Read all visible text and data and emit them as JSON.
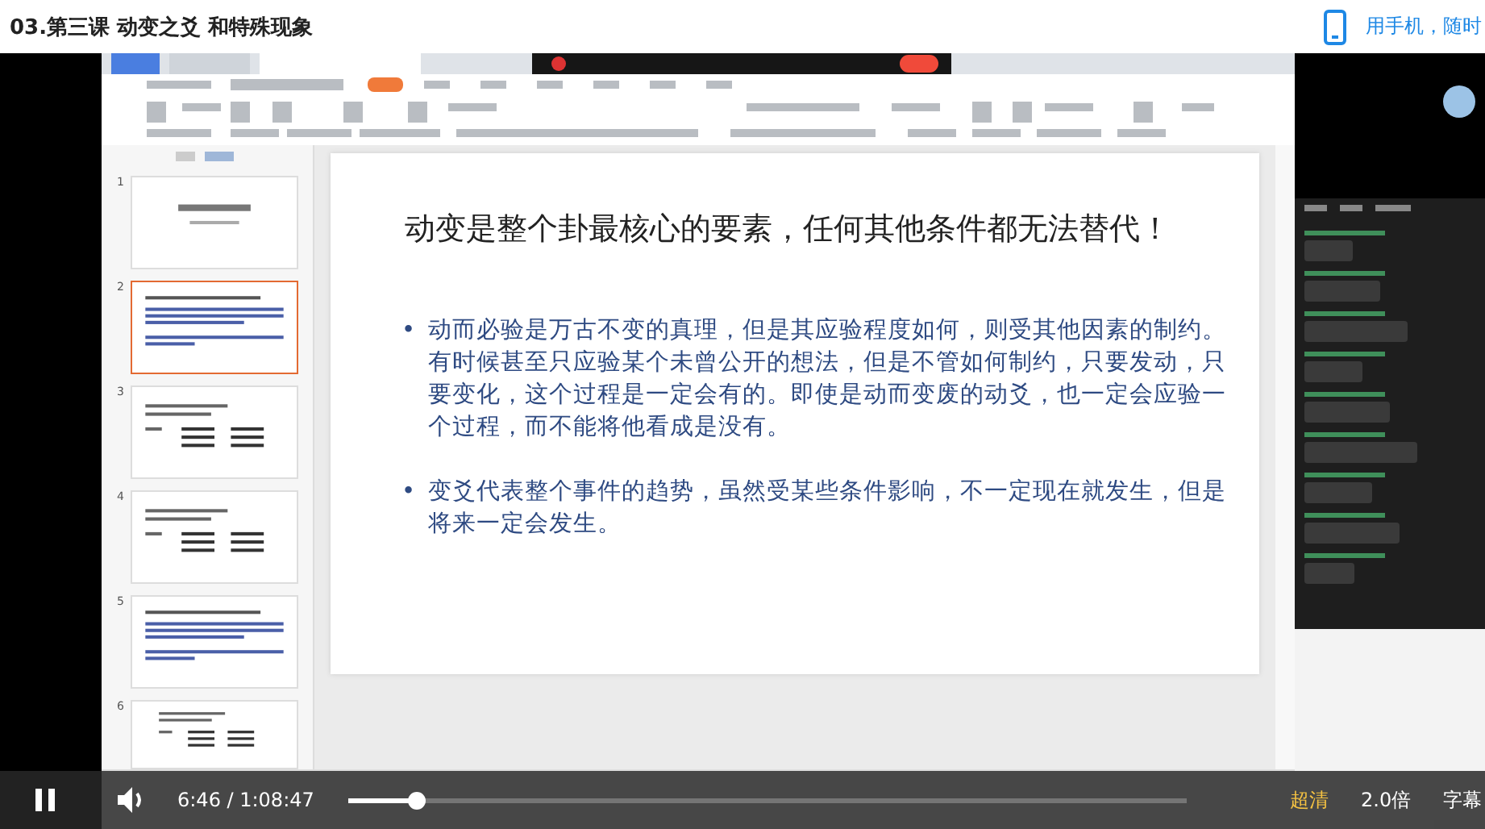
{
  "page": {
    "title": "03.第三课 动变之爻 和特殊现象",
    "mobile_link": "用手机，随时"
  },
  "slides": {
    "thumbnails": [
      {
        "number": "1",
        "selected": false,
        "kind": "title"
      },
      {
        "number": "2",
        "selected": true,
        "kind": "text"
      },
      {
        "number": "3",
        "selected": false,
        "kind": "table"
      },
      {
        "number": "4",
        "selected": false,
        "kind": "table"
      },
      {
        "number": "5",
        "selected": false,
        "kind": "text"
      },
      {
        "number": "6",
        "selected": false,
        "kind": "table"
      }
    ],
    "current": {
      "title": "动变是整个卦最核心的要素，任何其他条件都无法替代！",
      "bullets": [
        {
          "marker": "•",
          "text": "动而必验是万古不变的真理，但是其应验程度如何，则受其他因素的制约。有时候甚至只应验某个未曾公开的想法，但是不管如何制约，只要发动，只要变化，这个过程是一定会有的。即使是动而变废的动爻，也一定会应验一个过程，而不能将他看成是没有。"
        },
        {
          "marker": "•",
          "text": "变爻代表整个事件的趋势，虽然受某些条件影响，不一定现在就发生，但是将来一定会发生。"
        }
      ]
    }
  },
  "player": {
    "playing": true,
    "time": "6:46 / 1:08:47",
    "level": 0.08,
    "quality": "超清",
    "speed": "2.0倍",
    "subtitles": "字幕"
  }
}
